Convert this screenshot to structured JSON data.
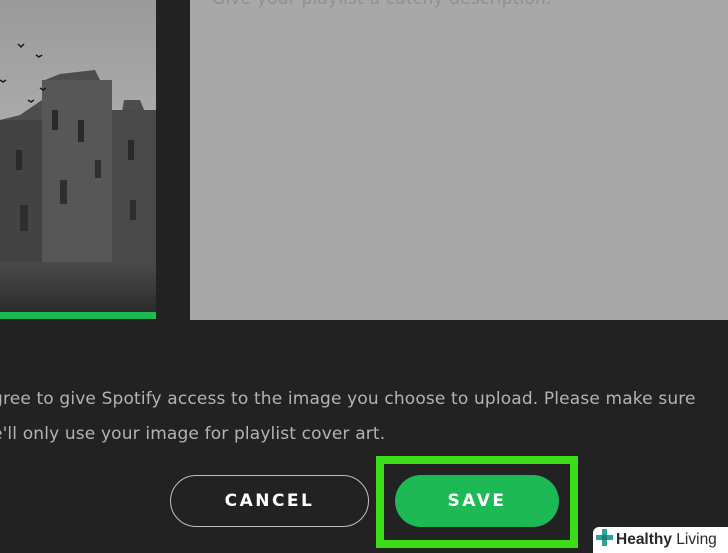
{
  "cover": {
    "image": "castle-photo",
    "accent_color": "#1db954"
  },
  "description": {
    "placeholder": "Give your playlist a catchy description."
  },
  "consent": {
    "line1": "gree to give Spotify access to the image you choose to upload. Please make sure",
    "line2": "e'll only use your image for playlist cover art."
  },
  "buttons": {
    "cancel_label": "CANCEL",
    "save_label": "SAVE",
    "save_color": "#1db954",
    "highlight_color": "#3ddc1a"
  },
  "watermark": {
    "brand_bold": "Healthy",
    "brand_rest": " Living",
    "icon": "plus-cross-icon"
  }
}
